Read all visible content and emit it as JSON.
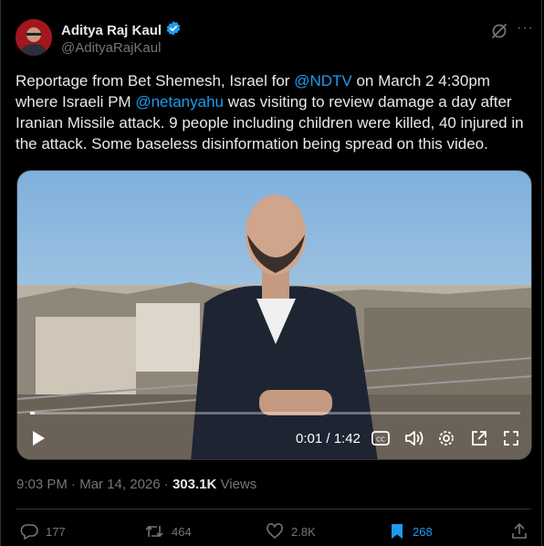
{
  "author": {
    "name": "Aditya Raj Kaul",
    "handle": "@AdityaRajKaul",
    "verified": true
  },
  "tweet": {
    "text_parts": [
      {
        "t": "Reportage from Bet Shemesh, Israel for "
      },
      {
        "t": "@NDTV",
        "mention": true
      },
      {
        "t": " on March 2 4:30pm where Israeli PM "
      },
      {
        "t": "@netanyahu",
        "mention": true
      },
      {
        "t": " was visiting to review damage a day after Iranian Missile attack. 9 people including children were killed, 40 injured in the attack. Some baseless disinformation being spread on this video."
      }
    ]
  },
  "video": {
    "time_label": "0:01 / 1:42",
    "progress": 0.01,
    "controls": [
      "play-icon",
      "captions-icon",
      "volume-icon",
      "settings-icon",
      "popout-icon",
      "fullscreen-icon"
    ]
  },
  "meta": {
    "time": "9:03 PM",
    "sep": "·",
    "date": "Mar 14, 2026",
    "views_count": "303.1K",
    "views_label": "Views"
  },
  "actions": {
    "replies": "177",
    "reposts": "464",
    "likes": "2.8K",
    "bookmarks": "268"
  },
  "colors": {
    "accent": "#1d9bf0",
    "text": "#e7e9ea",
    "muted": "#71767b",
    "border": "#2f3336",
    "background": "#000000"
  }
}
